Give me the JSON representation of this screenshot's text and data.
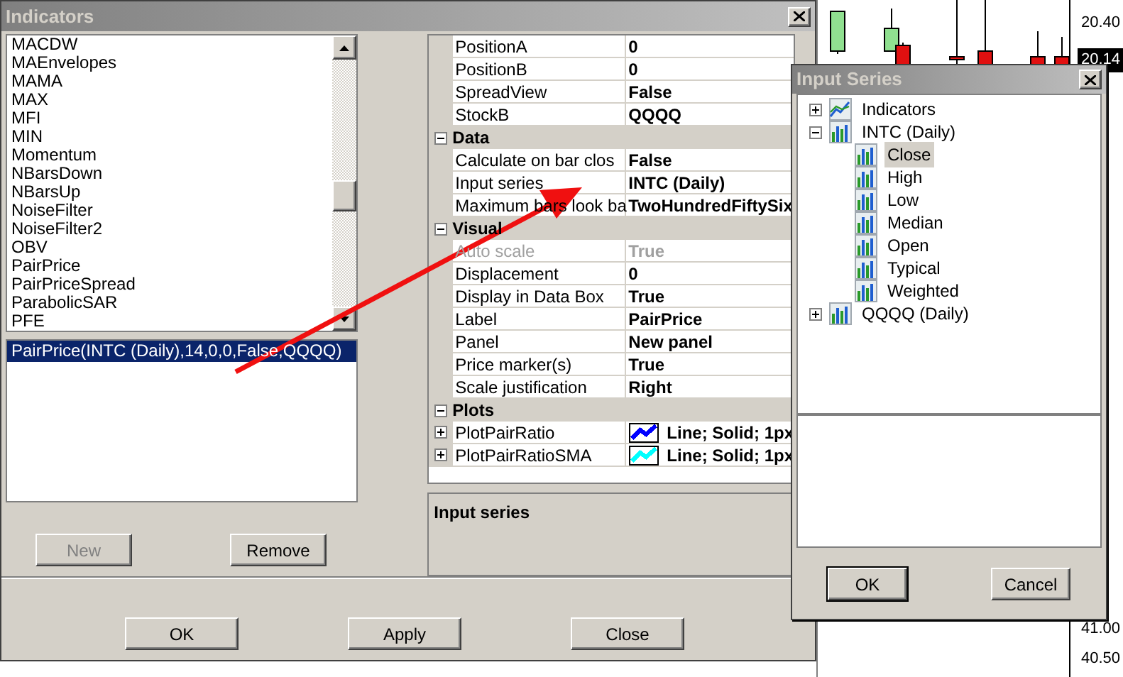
{
  "indicators_window": {
    "title": "Indicators",
    "available_list": [
      {
        "label": "MACDW",
        "selected": false
      },
      {
        "label": "MAEnvelopes",
        "selected": false
      },
      {
        "label": "MAMA",
        "selected": false
      },
      {
        "label": "MAX",
        "selected": false
      },
      {
        "label": "MFI",
        "selected": false
      },
      {
        "label": "MIN",
        "selected": false
      },
      {
        "label": "Momentum",
        "selected": false
      },
      {
        "label": "NBarsDown",
        "selected": false
      },
      {
        "label": "NBarsUp",
        "selected": false
      },
      {
        "label": "NoiseFilter",
        "selected": false
      },
      {
        "label": "NoiseFilter2",
        "selected": false
      },
      {
        "label": "OBV",
        "selected": false
      },
      {
        "label": "PairPrice",
        "selected": false
      },
      {
        "label": "PairPriceSpread",
        "selected": false
      },
      {
        "label": "ParabolicSAR",
        "selected": false
      },
      {
        "label": "PFE",
        "selected": false
      }
    ],
    "applied_list": [
      {
        "label": "PairPrice(INTC (Daily),14,0,0,False,QQQQ)",
        "selected": true
      }
    ],
    "list_buttons": [
      {
        "label": "New",
        "disabled": true
      },
      {
        "label": "Remove",
        "disabled": false
      }
    ],
    "properties": [
      {
        "kind": "property",
        "name": "PositionA",
        "value": "0",
        "disabled": false
      },
      {
        "kind": "property",
        "name": "PositionB",
        "value": "0",
        "disabled": false
      },
      {
        "kind": "property",
        "name": "SpreadView",
        "value": "False",
        "disabled": false
      },
      {
        "kind": "property",
        "name": "StockB",
        "value": "QQQQ",
        "disabled": false
      },
      {
        "kind": "category",
        "name": "Data",
        "expanded": true
      },
      {
        "kind": "property",
        "name": "Calculate on bar clos",
        "value": "False",
        "disabled": false
      },
      {
        "kind": "property",
        "name": "Input series",
        "value": "INTC (Daily)",
        "disabled": false
      },
      {
        "kind": "property",
        "name": "Maximum bars look ba",
        "value": "TwoHundredFiftySix",
        "disabled": false
      },
      {
        "kind": "category",
        "name": "Visual",
        "expanded": true
      },
      {
        "kind": "property",
        "name": "Auto scale",
        "value": "True",
        "disabled": true
      },
      {
        "kind": "property",
        "name": "Displacement",
        "value": "0",
        "disabled": false
      },
      {
        "kind": "property",
        "name": "Display in Data Box",
        "value": "True",
        "disabled": false
      },
      {
        "kind": "property",
        "name": "Label",
        "value": "PairPrice",
        "disabled": false
      },
      {
        "kind": "property",
        "name": "Panel",
        "value": "New panel",
        "disabled": false
      },
      {
        "kind": "property",
        "name": "Price marker(s)",
        "value": "True",
        "disabled": false
      },
      {
        "kind": "property",
        "name": "Scale justification",
        "value": "Right",
        "disabled": false
      },
      {
        "kind": "category",
        "name": "Plots",
        "expanded": true
      },
      {
        "kind": "plot",
        "name": "PlotPairRatio",
        "value": "Line; Solid; 1px",
        "color": "#0000ff",
        "expanded": false
      },
      {
        "kind": "plot",
        "name": "PlotPairRatioSMA",
        "value": "Line; Solid; 1px",
        "color": "#00ffff",
        "expanded": false
      }
    ],
    "description": "Input series",
    "buttons": [
      "OK",
      "Apply",
      "Close"
    ]
  },
  "chart": {
    "price_labels": [
      {
        "text": "20.40",
        "kind": "tick"
      },
      {
        "text": "20.14",
        "kind": "marker"
      },
      {
        "text": "41.00",
        "kind": "tick"
      },
      {
        "text": "40.50",
        "kind": "tick"
      }
    ]
  },
  "input_series_window": {
    "title": "Input Series",
    "tree": [
      {
        "label": "Indicators",
        "kind": "indicators",
        "expanded": false,
        "selected": false
      },
      {
        "label": "INTC (Daily)",
        "kind": "series",
        "expanded": true,
        "selected": false,
        "children": [
          {
            "label": "Close",
            "kind": "series",
            "selected": true
          },
          {
            "label": "High",
            "kind": "series",
            "selected": false
          },
          {
            "label": "Low",
            "kind": "series",
            "selected": false
          },
          {
            "label": "Median",
            "kind": "series",
            "selected": false
          },
          {
            "label": "Open",
            "kind": "series",
            "selected": false
          },
          {
            "label": "Typical",
            "kind": "series",
            "selected": false
          },
          {
            "label": "Weighted",
            "kind": "series",
            "selected": false
          }
        ]
      },
      {
        "label": "QQQQ (Daily)",
        "kind": "series",
        "expanded": false,
        "selected": false
      }
    ],
    "buttons": [
      {
        "label": "OK",
        "default": true
      },
      {
        "label": "Cancel",
        "default": false
      }
    ]
  }
}
